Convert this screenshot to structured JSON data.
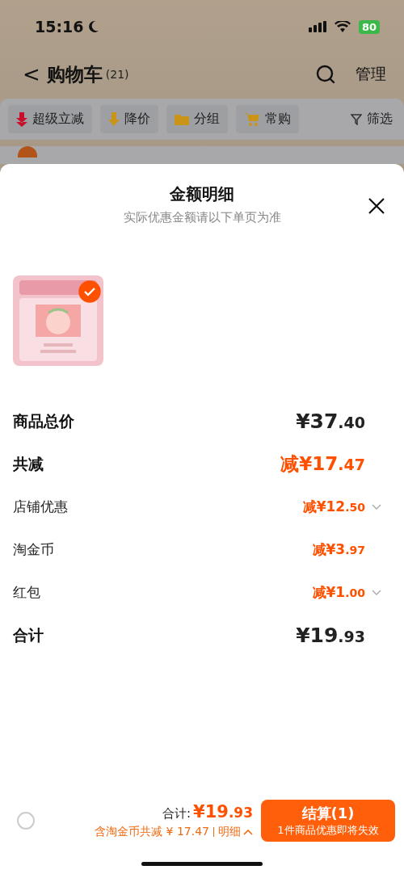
{
  "status_bar": {
    "time": "15:16",
    "battery": "80"
  },
  "header": {
    "back": "<",
    "title": "购物车",
    "count": "(21)",
    "manage": "管理"
  },
  "filters": [
    {
      "label": "超级立减",
      "kind": "super"
    },
    {
      "label": "降价",
      "kind": "drop"
    },
    {
      "label": "分组",
      "kind": "folder"
    },
    {
      "label": "常购",
      "kind": "cart"
    },
    {
      "label": "筛选",
      "kind": "filter"
    }
  ],
  "sheet": {
    "title": "金额明细",
    "subtitle": "实际优惠金额请以下单页为准",
    "products": [
      {
        "kind": "picture",
        "selected": true
      }
    ],
    "rows": [
      {
        "label": "商品总价",
        "kind": "total",
        "prefix": "",
        "integer": "¥37",
        "decimal": ".40",
        "expandable": false
      },
      {
        "label": "共减",
        "kind": "discount_total",
        "prefix": "减",
        "integer": "¥17",
        "decimal": ".47",
        "expandable": false
      },
      {
        "label": "店铺优惠",
        "kind": "discount",
        "prefix": "减",
        "integer": "¥12",
        "decimal": ".50",
        "expandable": true
      },
      {
        "label": "淘金币",
        "kind": "discount",
        "prefix": "减",
        "integer": "¥3",
        "decimal": ".97",
        "expandable": false
      },
      {
        "label": "红包",
        "kind": "discount",
        "prefix": "减",
        "integer": "¥1",
        "decimal": ".00",
        "expandable": true
      },
      {
        "label": "合计",
        "kind": "total",
        "prefix": "",
        "integer": "¥19",
        "decimal": ".93",
        "expandable": false
      }
    ]
  },
  "bottom_bar": {
    "select_all": {
      "checked": false
    },
    "total_label": "合计:",
    "total_integer": "¥19",
    "total_decimal": ".93",
    "savings": "含淘金币共减 ¥ 17.47",
    "detail": "明细",
    "checkout": "结算(1)",
    "checkout_note": "1件商品优惠即将失效"
  }
}
